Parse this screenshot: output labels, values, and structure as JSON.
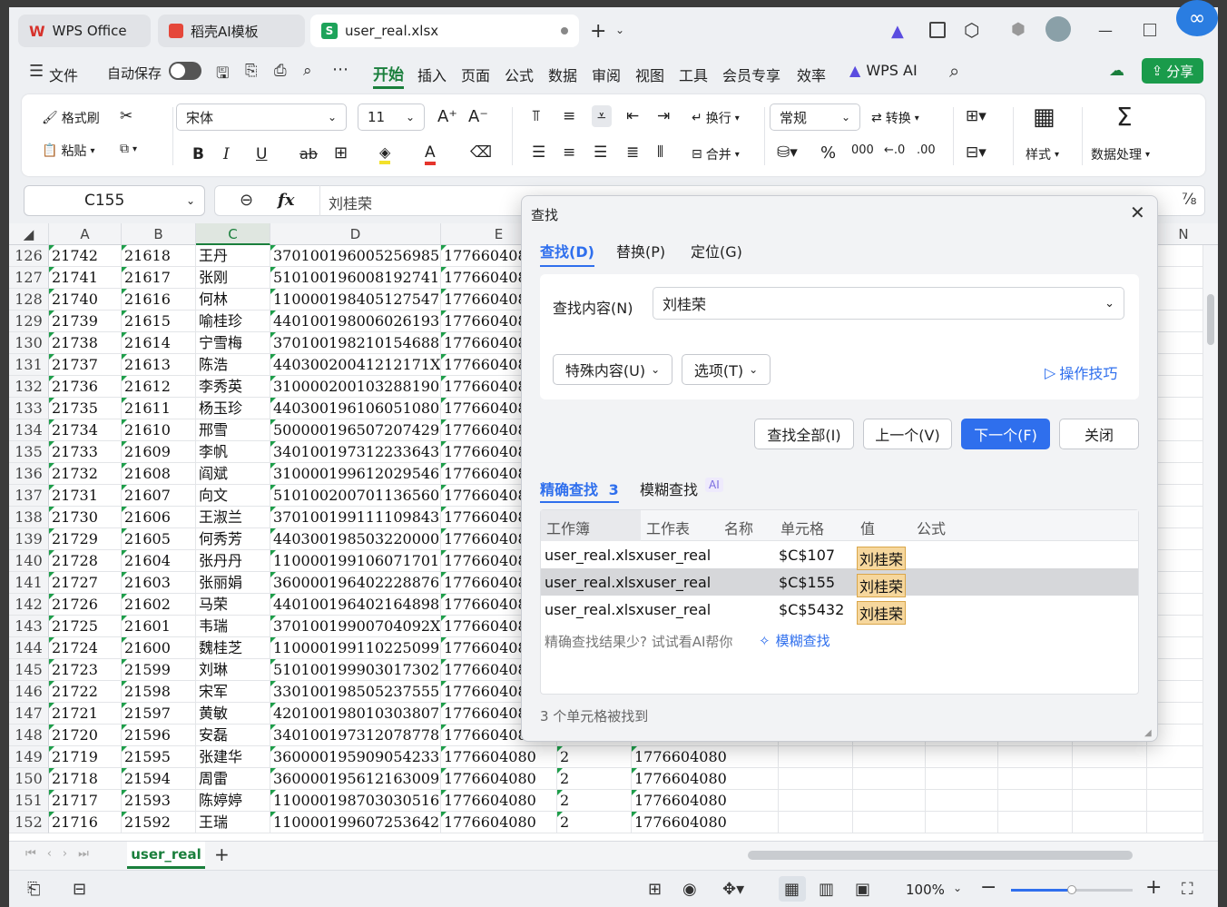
{
  "titlebar": {
    "tabs": [
      {
        "label": "WPS Office"
      },
      {
        "label": "稻壳AI模板"
      },
      {
        "label": "user_real.xlsx"
      }
    ]
  },
  "menubar": {
    "file": "文件",
    "autosave": "自动保存",
    "items": [
      "开始",
      "插入",
      "页面",
      "公式",
      "数据",
      "审阅",
      "视图",
      "工具",
      "会员专享",
      "效率"
    ],
    "wps_ai": "WPS AI",
    "share": "分享"
  },
  "ribbon": {
    "format_painter": "格式刷",
    "paste": "粘贴",
    "font_name": "宋体",
    "font_size": "11",
    "wrap": "换行",
    "merge": "合并",
    "number_format": "常规",
    "convert": "转换",
    "styles": "样式",
    "data_processing": "数据处理",
    "bold": "B",
    "italic": "I",
    "underline": "U",
    "strike": "ab"
  },
  "formula_bar": {
    "name_box": "C155",
    "fx": "fx",
    "content": "刘桂荣"
  },
  "grid": {
    "columns": [
      "A",
      "B",
      "C",
      "D",
      "E",
      "N"
    ],
    "rows": [
      {
        "n": "126",
        "a": "21742",
        "b": "21618",
        "c": "王丹",
        "d": "370100196005256985",
        "e": "177660408"
      },
      {
        "n": "127",
        "a": "21741",
        "b": "21617",
        "c": "张刚",
        "d": "510100196008192741",
        "e": "177660408"
      },
      {
        "n": "128",
        "a": "21740",
        "b": "21616",
        "c": "何林",
        "d": "110000198405127547",
        "e": "177660408"
      },
      {
        "n": "129",
        "a": "21739",
        "b": "21615",
        "c": "喻桂珍",
        "d": "440100198006026193",
        "e": "177660408"
      },
      {
        "n": "130",
        "a": "21738",
        "b": "21614",
        "c": "宁雪梅",
        "d": "370100198210154688",
        "e": "177660408"
      },
      {
        "n": "131",
        "a": "21737",
        "b": "21613",
        "c": "陈浩",
        "d": "44030020041212171X",
        "e": "177660408"
      },
      {
        "n": "132",
        "a": "21736",
        "b": "21612",
        "c": "李秀英",
        "d": "310000200103288190",
        "e": "177660408"
      },
      {
        "n": "133",
        "a": "21735",
        "b": "21611",
        "c": "杨玉珍",
        "d": "440300196106051080",
        "e": "177660408"
      },
      {
        "n": "134",
        "a": "21734",
        "b": "21610",
        "c": "邢雪",
        "d": "500000196507207429",
        "e": "177660408"
      },
      {
        "n": "135",
        "a": "21733",
        "b": "21609",
        "c": "李帆",
        "d": "340100197312233643",
        "e": "177660408"
      },
      {
        "n": "136",
        "a": "21732",
        "b": "21608",
        "c": "阎斌",
        "d": "310000199612029546",
        "e": "177660408"
      },
      {
        "n": "137",
        "a": "21731",
        "b": "21607",
        "c": "向文",
        "d": "510100200701136560",
        "e": "177660408"
      },
      {
        "n": "138",
        "a": "21730",
        "b": "21606",
        "c": "王淑兰",
        "d": "370100199111109843",
        "e": "177660408"
      },
      {
        "n": "139",
        "a": "21729",
        "b": "21605",
        "c": "何秀芳",
        "d": "440300198503220000",
        "e": "177660408"
      },
      {
        "n": "140",
        "a": "21728",
        "b": "21604",
        "c": "张丹丹",
        "d": "110000199106071701",
        "e": "177660408"
      },
      {
        "n": "141",
        "a": "21727",
        "b": "21603",
        "c": "张丽娟",
        "d": "360000196402228876",
        "e": "177660408"
      },
      {
        "n": "142",
        "a": "21726",
        "b": "21602",
        "c": "马荣",
        "d": "440100196402164898",
        "e": "177660408"
      },
      {
        "n": "143",
        "a": "21725",
        "b": "21601",
        "c": "韦瑞",
        "d": "37010019900704092X",
        "e": "177660408"
      },
      {
        "n": "144",
        "a": "21724",
        "b": "21600",
        "c": "魏桂芝",
        "d": "110000199110225099",
        "e": "177660408"
      },
      {
        "n": "145",
        "a": "21723",
        "b": "21599",
        "c": "刘琳",
        "d": "510100199903017302",
        "e": "177660408"
      },
      {
        "n": "146",
        "a": "21722",
        "b": "21598",
        "c": "宋军",
        "d": "330100198505237555",
        "e": "177660408"
      },
      {
        "n": "147",
        "a": "21721",
        "b": "21597",
        "c": "黄敏",
        "d": "420100198010303807",
        "e": "177660408"
      },
      {
        "n": "148",
        "a": "21720",
        "b": "21596",
        "c": "安磊",
        "d": "340100197312078778",
        "e": "177660408"
      },
      {
        "n": "149",
        "a": "21719",
        "b": "21595",
        "c": "张建华",
        "d": "360000195909054233",
        "e": "1776604080",
        "f": "2",
        "g": "1776604080"
      },
      {
        "n": "150",
        "a": "21718",
        "b": "21594",
        "c": "周雷",
        "d": "360000195612163009",
        "e": "1776604080",
        "f": "2",
        "g": "1776604080"
      },
      {
        "n": "151",
        "a": "21717",
        "b": "21593",
        "c": "陈婷婷",
        "d": "110000198703030516",
        "e": "1776604080",
        "f": "2",
        "g": "1776604080"
      },
      {
        "n": "152",
        "a": "21716",
        "b": "21592",
        "c": "王瑞",
        "d": "110000199607253642",
        "e": "1776604080",
        "f": "2",
        "g": "1776604080"
      }
    ]
  },
  "sheet_tabs": {
    "active": "user_real"
  },
  "status": {
    "zoom": "100%"
  },
  "find_dialog": {
    "title": "查找",
    "tabs": [
      "查找(D)",
      "替换(P)",
      "定位(G)"
    ],
    "find_label": "查找内容(N)",
    "find_value": "刘桂荣",
    "special": "特殊内容(U)",
    "options": "选项(T)",
    "tips": "操作技巧",
    "buttons": {
      "find_all": "查找全部(I)",
      "prev": "上一个(V)",
      "next": "下一个(F)",
      "close": "关闭"
    },
    "result_tabs": {
      "exact": "精确查找",
      "exact_count": "3",
      "fuzzy": "模糊查找",
      "ai": "AI"
    },
    "table_headers": [
      "工作簿",
      "工作表",
      "名称",
      "单元格",
      "值",
      "公式"
    ],
    "results": [
      {
        "book": "user_real.xlsx",
        "sheet": "user_real",
        "name": "",
        "cell": "$C$107",
        "value": "刘桂荣",
        "formula": ""
      },
      {
        "book": "user_real.xlsx",
        "sheet": "user_real",
        "name": "",
        "cell": "$C$155",
        "value": "刘桂荣",
        "formula": ""
      },
      {
        "book": "user_real.xlsx",
        "sheet": "user_real",
        "name": "",
        "cell": "$C$5432",
        "value": "刘桂荣",
        "formula": ""
      }
    ],
    "ai_hint": "精确查找结果少? 试试看AI帮你",
    "ai_link": "模糊查找",
    "footer": "3 个单元格被找到"
  }
}
